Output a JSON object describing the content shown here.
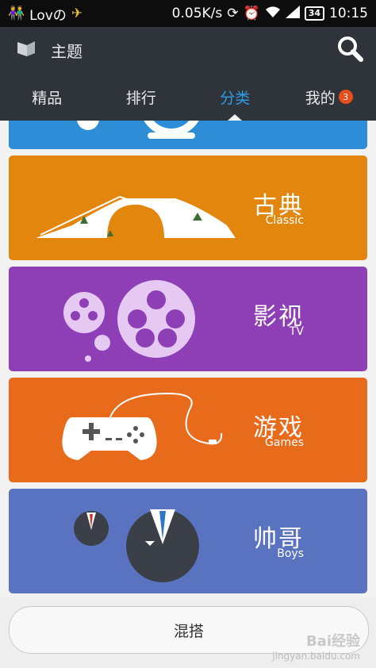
{
  "status_bar": {
    "carrier": "Lovの",
    "speed": "0.05K/s",
    "battery": "34",
    "time": "10:15"
  },
  "header": {
    "title": "主题",
    "search_icon": "search-icon"
  },
  "tabs": [
    {
      "label": "精品"
    },
    {
      "label": "排行"
    },
    {
      "label": "分类",
      "active": true
    },
    {
      "label": "我的",
      "badge": "3"
    }
  ],
  "categories": [
    {
      "title": "古典",
      "subtitle": "Classic",
      "color": "#e2860e"
    },
    {
      "title": "影视",
      "subtitle": "TV",
      "color": "#8f3fb5"
    },
    {
      "title": "游戏",
      "subtitle": "Games",
      "color": "#e86a1b"
    },
    {
      "title": "帅哥",
      "subtitle": "Boys",
      "color": "#5a73c0"
    }
  ],
  "top_card_color": "#2d8dd6",
  "bottom": {
    "button_label": "混搭",
    "watermark": "Bai经验",
    "watermark_url_text": "jingyan.baidu.com"
  }
}
